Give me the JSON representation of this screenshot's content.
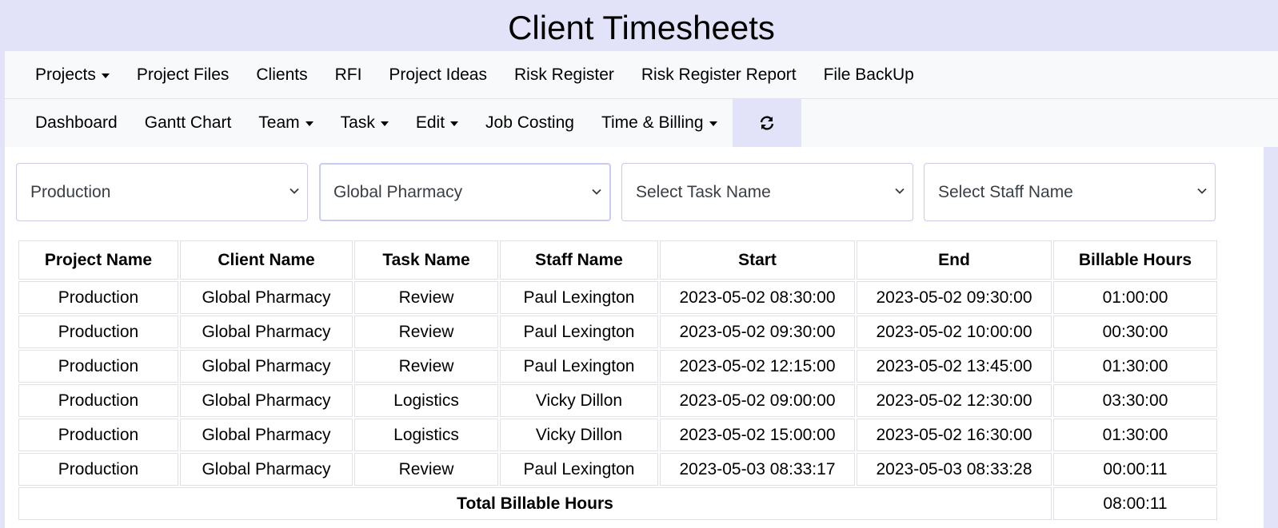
{
  "app": {
    "title": "Client Timesheets"
  },
  "nav_row1": [
    {
      "label": "Projects",
      "dropdown": true
    },
    {
      "label": "Project Files",
      "dropdown": false
    },
    {
      "label": "Clients",
      "dropdown": false
    },
    {
      "label": "RFI",
      "dropdown": false
    },
    {
      "label": "Project Ideas",
      "dropdown": false
    },
    {
      "label": "Risk Register",
      "dropdown": false
    },
    {
      "label": "Risk Register Report",
      "dropdown": false
    },
    {
      "label": "File BackUp",
      "dropdown": false
    }
  ],
  "nav_row2": [
    {
      "label": "Dashboard",
      "dropdown": false
    },
    {
      "label": "Gantt Chart",
      "dropdown": false
    },
    {
      "label": "Team",
      "dropdown": true
    },
    {
      "label": "Task",
      "dropdown": true
    },
    {
      "label": "Edit",
      "dropdown": true
    },
    {
      "label": "Job Costing",
      "dropdown": false
    },
    {
      "label": "Time & Billing",
      "dropdown": true
    }
  ],
  "refresh": {
    "icon": "refresh-icon"
  },
  "filters": {
    "project": {
      "value": "Production"
    },
    "client": {
      "value": "Global Pharmacy"
    },
    "task": {
      "placeholder": "Select Task Name"
    },
    "staff": {
      "placeholder": "Select Staff Name"
    }
  },
  "table": {
    "headers": [
      "Project Name",
      "Client Name",
      "Task Name",
      "Staff Name",
      "Start",
      "End",
      "Billable Hours"
    ],
    "rows": [
      [
        "Production",
        "Global Pharmacy",
        "Review",
        "Paul Lexington",
        "2023-05-02 08:30:00",
        "2023-05-02 09:30:00",
        "01:00:00"
      ],
      [
        "Production",
        "Global Pharmacy",
        "Review",
        "Paul Lexington",
        "2023-05-02 09:30:00",
        "2023-05-02 10:00:00",
        "00:30:00"
      ],
      [
        "Production",
        "Global Pharmacy",
        "Review",
        "Paul Lexington",
        "2023-05-02 12:15:00",
        "2023-05-02 13:45:00",
        "01:30:00"
      ],
      [
        "Production",
        "Global Pharmacy",
        "Logistics",
        "Vicky Dillon",
        "2023-05-02 09:00:00",
        "2023-05-02 12:30:00",
        "03:30:00"
      ],
      [
        "Production",
        "Global Pharmacy",
        "Logistics",
        "Vicky Dillon",
        "2023-05-02 15:00:00",
        "2023-05-02 16:30:00",
        "01:30:00"
      ],
      [
        "Production",
        "Global Pharmacy",
        "Review",
        "Paul Lexington",
        "2023-05-03 08:33:17",
        "2023-05-03 08:33:28",
        "00:00:11"
      ]
    ],
    "total_label": "Total Billable Hours",
    "total_value": "08:00:11"
  }
}
